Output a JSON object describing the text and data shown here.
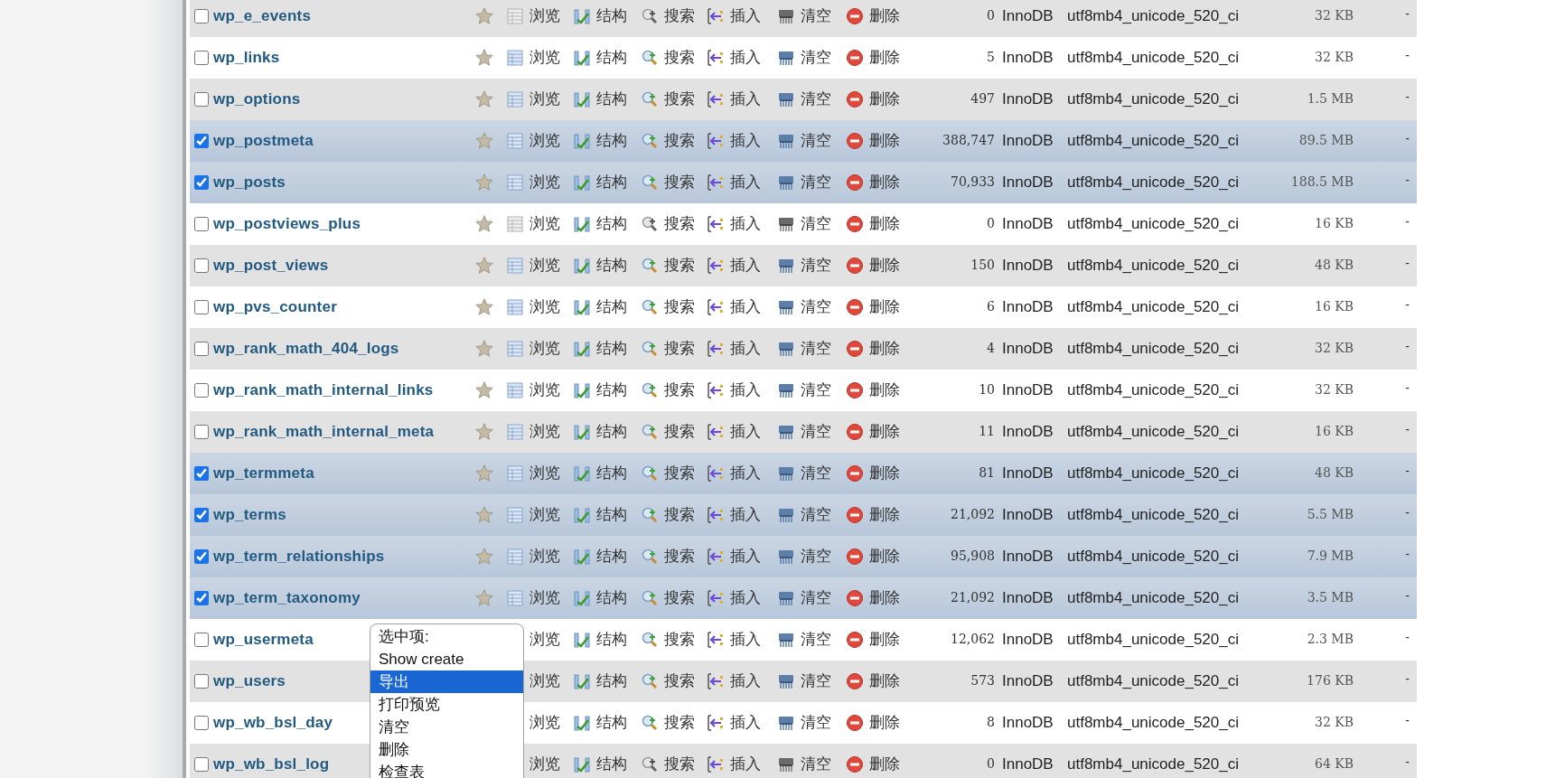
{
  "tables": [
    {
      "name": "wp_e_events",
      "checked": false,
      "empty": true,
      "actions": [
        "浏览",
        "结构",
        "搜索",
        "插入",
        "清空",
        "删除"
      ],
      "rows": "0",
      "engine": "InnoDB",
      "collation": "utf8mb4_unicode_520_ci",
      "size": "32 KB",
      "overhead": "-"
    },
    {
      "name": "wp_links",
      "checked": false,
      "empty": false,
      "actions": [
        "浏览",
        "结构",
        "搜索",
        "插入",
        "清空",
        "删除"
      ],
      "rows": "5",
      "engine": "InnoDB",
      "collation": "utf8mb4_unicode_520_ci",
      "size": "32 KB",
      "overhead": "-"
    },
    {
      "name": "wp_options",
      "checked": false,
      "empty": false,
      "actions": [
        "浏览",
        "结构",
        "搜索",
        "插入",
        "清空",
        "删除"
      ],
      "rows": "497",
      "engine": "InnoDB",
      "collation": "utf8mb4_unicode_520_ci",
      "size": "1.5 MB",
      "overhead": "-"
    },
    {
      "name": "wp_postmeta",
      "checked": true,
      "empty": false,
      "actions": [
        "浏览",
        "结构",
        "搜索",
        "插入",
        "清空",
        "删除"
      ],
      "rows": "388,747",
      "engine": "InnoDB",
      "collation": "utf8mb4_unicode_520_ci",
      "size": "89.5 MB",
      "overhead": "-"
    },
    {
      "name": "wp_posts",
      "checked": true,
      "empty": false,
      "actions": [
        "浏览",
        "结构",
        "搜索",
        "插入",
        "清空",
        "删除"
      ],
      "rows": "70,933",
      "engine": "InnoDB",
      "collation": "utf8mb4_unicode_520_ci",
      "size": "188.5 MB",
      "overhead": "-"
    },
    {
      "name": "wp_postviews_plus",
      "checked": false,
      "empty": true,
      "actions": [
        "浏览",
        "结构",
        "搜索",
        "插入",
        "清空",
        "删除"
      ],
      "rows": "0",
      "engine": "InnoDB",
      "collation": "utf8mb4_unicode_520_ci",
      "size": "16 KB",
      "overhead": "-"
    },
    {
      "name": "wp_post_views",
      "checked": false,
      "empty": false,
      "actions": [
        "浏览",
        "结构",
        "搜索",
        "插入",
        "清空",
        "删除"
      ],
      "rows": "150",
      "engine": "InnoDB",
      "collation": "utf8mb4_unicode_520_ci",
      "size": "48 KB",
      "overhead": "-"
    },
    {
      "name": "wp_pvs_counter",
      "checked": false,
      "empty": false,
      "actions": [
        "浏览",
        "结构",
        "搜索",
        "插入",
        "清空",
        "删除"
      ],
      "rows": "6",
      "engine": "InnoDB",
      "collation": "utf8mb4_unicode_520_ci",
      "size": "16 KB",
      "overhead": "-"
    },
    {
      "name": "wp_rank_math_404_logs",
      "checked": false,
      "empty": false,
      "actions": [
        "浏览",
        "结构",
        "搜索",
        "插入",
        "清空",
        "删除"
      ],
      "rows": "4",
      "engine": "InnoDB",
      "collation": "utf8mb4_unicode_520_ci",
      "size": "32 KB",
      "overhead": "-"
    },
    {
      "name": "wp_rank_math_internal_links",
      "checked": false,
      "empty": false,
      "actions": [
        "浏览",
        "结构",
        "搜索",
        "插入",
        "清空",
        "删除"
      ],
      "rows": "10",
      "engine": "InnoDB",
      "collation": "utf8mb4_unicode_520_ci",
      "size": "32 KB",
      "overhead": "-"
    },
    {
      "name": "wp_rank_math_internal_meta",
      "checked": false,
      "empty": false,
      "actions": [
        "浏览",
        "结构",
        "搜索",
        "插入",
        "清空",
        "删除"
      ],
      "rows": "11",
      "engine": "InnoDB",
      "collation": "utf8mb4_unicode_520_ci",
      "size": "16 KB",
      "overhead": "-"
    },
    {
      "name": "wp_termmeta",
      "checked": true,
      "empty": false,
      "actions": [
        "浏览",
        "结构",
        "搜索",
        "插入",
        "清空",
        "删除"
      ],
      "rows": "81",
      "engine": "InnoDB",
      "collation": "utf8mb4_unicode_520_ci",
      "size": "48 KB",
      "overhead": "-"
    },
    {
      "name": "wp_terms",
      "checked": true,
      "empty": false,
      "actions": [
        "浏览",
        "结构",
        "搜索",
        "插入",
        "清空",
        "删除"
      ],
      "rows": "21,092",
      "engine": "InnoDB",
      "collation": "utf8mb4_unicode_520_ci",
      "size": "5.5 MB",
      "overhead": "-"
    },
    {
      "name": "wp_term_relationships",
      "checked": true,
      "empty": false,
      "actions": [
        "浏览",
        "结构",
        "搜索",
        "插入",
        "清空",
        "删除"
      ],
      "rows": "95,908",
      "engine": "InnoDB",
      "collation": "utf8mb4_unicode_520_ci",
      "size": "7.9 MB",
      "overhead": "-"
    },
    {
      "name": "wp_term_taxonomy",
      "checked": true,
      "empty": false,
      "actions": [
        "浏览",
        "结构",
        "搜索",
        "插入",
        "清空",
        "删除"
      ],
      "rows": "21,092",
      "engine": "InnoDB",
      "collation": "utf8mb4_unicode_520_ci",
      "size": "3.5 MB",
      "overhead": "-"
    },
    {
      "name": "wp_usermeta",
      "checked": false,
      "empty": false,
      "actions": [
        "浏览",
        "结构",
        "搜索",
        "插入",
        "清空",
        "删除"
      ],
      "rows": "12,062",
      "engine": "InnoDB",
      "collation": "utf8mb4_unicode_520_ci",
      "size": "2.3 MB",
      "overhead": "-"
    },
    {
      "name": "wp_users",
      "checked": false,
      "empty": false,
      "actions": [
        "浏览",
        "结构",
        "搜索",
        "插入",
        "清空",
        "删除"
      ],
      "rows": "573",
      "engine": "InnoDB",
      "collation": "utf8mb4_unicode_520_ci",
      "size": "176 KB",
      "overhead": "-"
    },
    {
      "name": "wp_wb_bsl_day",
      "checked": false,
      "empty": false,
      "actions": [
        "浏览",
        "结构",
        "搜索",
        "插入",
        "清空",
        "删除"
      ],
      "rows": "8",
      "engine": "InnoDB",
      "collation": "utf8mb4_unicode_520_ci",
      "size": "32 KB",
      "overhead": "-"
    },
    {
      "name": "wp_wb_bsl_log",
      "checked": false,
      "empty": true,
      "actions": [
        "浏览",
        "结构",
        "搜索",
        "插入",
        "清空",
        "删除"
      ],
      "rows": "0",
      "engine": "InnoDB",
      "collation": "utf8mb4_unicode_520_ci",
      "size": "64 KB",
      "overhead": "-"
    }
  ],
  "with_selected_menu": {
    "items": [
      {
        "label": "选中项:",
        "selected": false
      },
      {
        "label": "Show create",
        "selected": false
      },
      {
        "label": "导出",
        "selected": true
      },
      {
        "label": "打印预览",
        "selected": false
      },
      {
        "label": "清空",
        "selected": false
      },
      {
        "label": "删除",
        "selected": false
      },
      {
        "label": "检查表",
        "selected": false
      }
    ]
  }
}
